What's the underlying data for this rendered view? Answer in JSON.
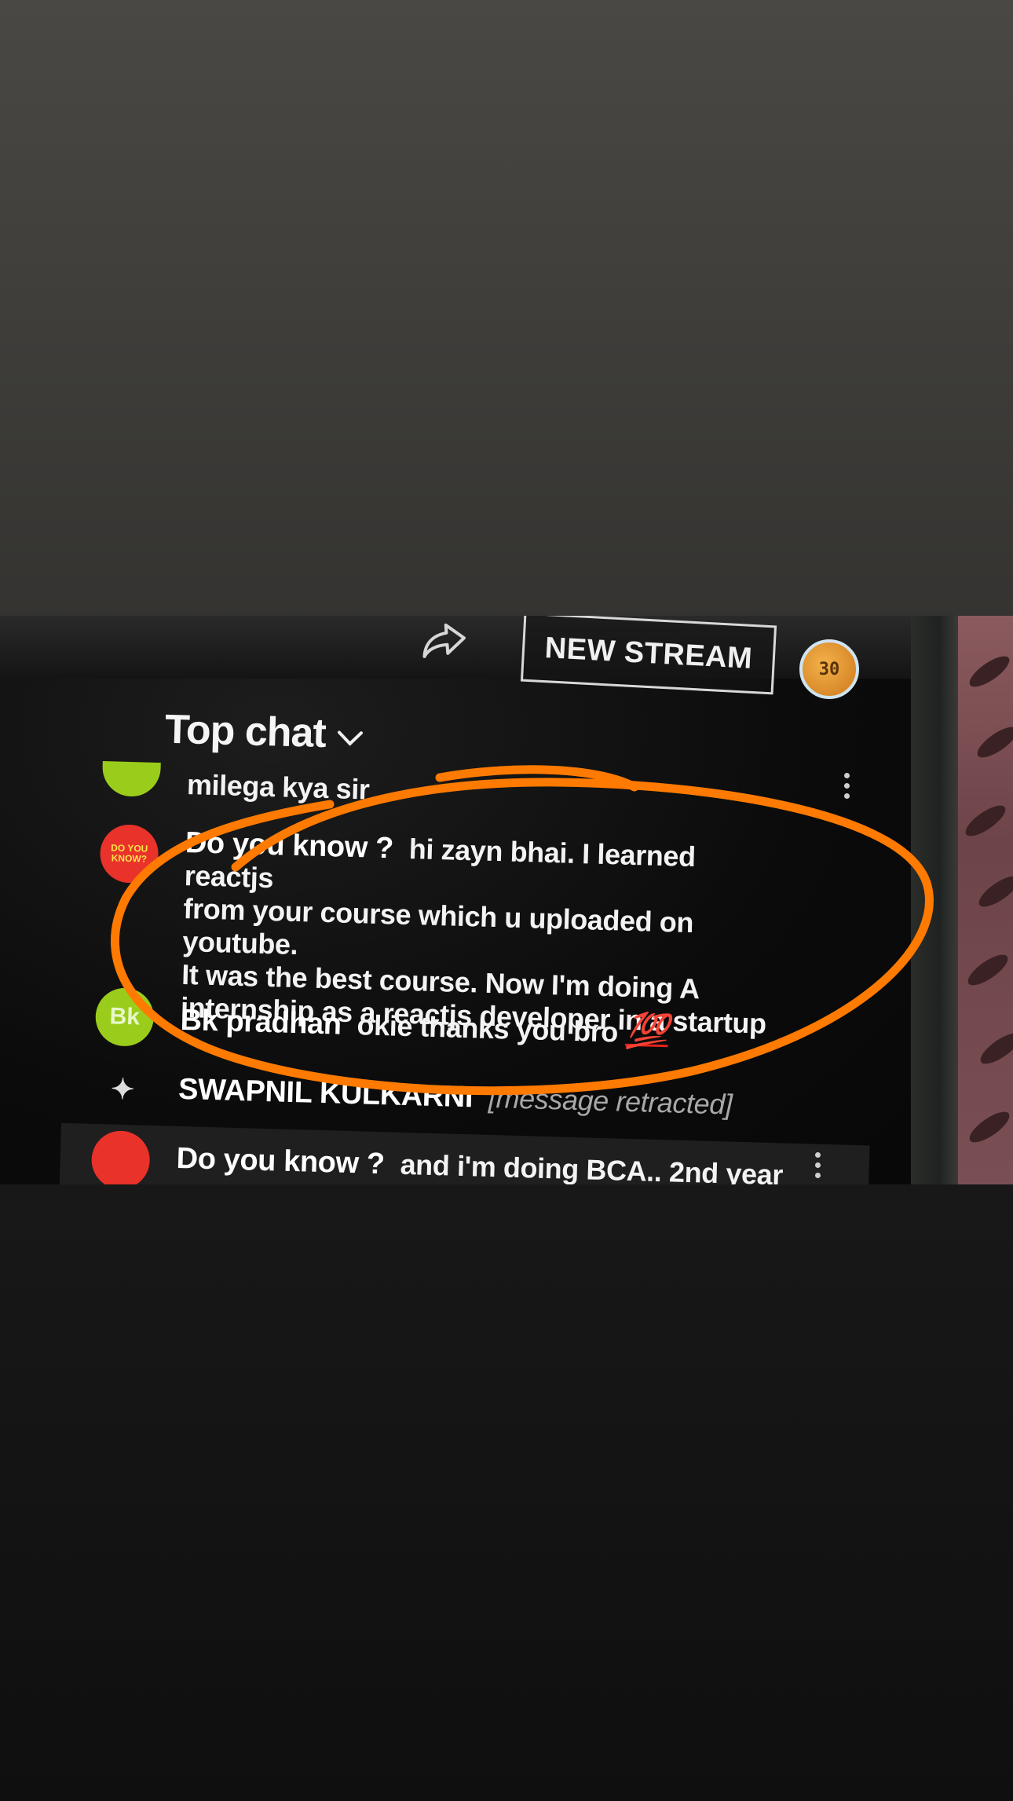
{
  "toolbar": {
    "share_icon": "share-arrow-icon",
    "new_stream_label": "NEW STREAM",
    "avatar_text": "30"
  },
  "chat": {
    "header_title": "Top chat",
    "messages": [
      {
        "author": "",
        "text": "milega kya sir",
        "avatar_color": "#9acd1b"
      },
      {
        "author": "Do you know ?",
        "text": "hi zayn bhai. I learned reactjs from your course which u uploaded on youtube. It was the best course. Now I'm doing A internship as a reactjs developer in a startup",
        "line1": "hi zayn bhai. I learned reactjs",
        "line2": "from your course which u uploaded on youtube.",
        "line3": "It was the best course. Now I'm doing A",
        "line4": "internship as a reactjs developer in a startup",
        "avatar_badge": "DO YOU KNOW?",
        "avatar_color": "#e8322a"
      },
      {
        "author": "Bk pradhan",
        "text": "okie thanks you bro",
        "emoji": "💯",
        "avatar_initials": "Bk",
        "avatar_color": "#9acd1b"
      },
      {
        "author": "SWAPNIL KULKARNI",
        "text": "[message retracted]"
      },
      {
        "author": "Do you know ?",
        "text": "and i'm doing BCA.. 2nd year",
        "avatar_color": "#e8322a"
      }
    ]
  },
  "annotation": {
    "stroke_color": "#ff7a00"
  }
}
